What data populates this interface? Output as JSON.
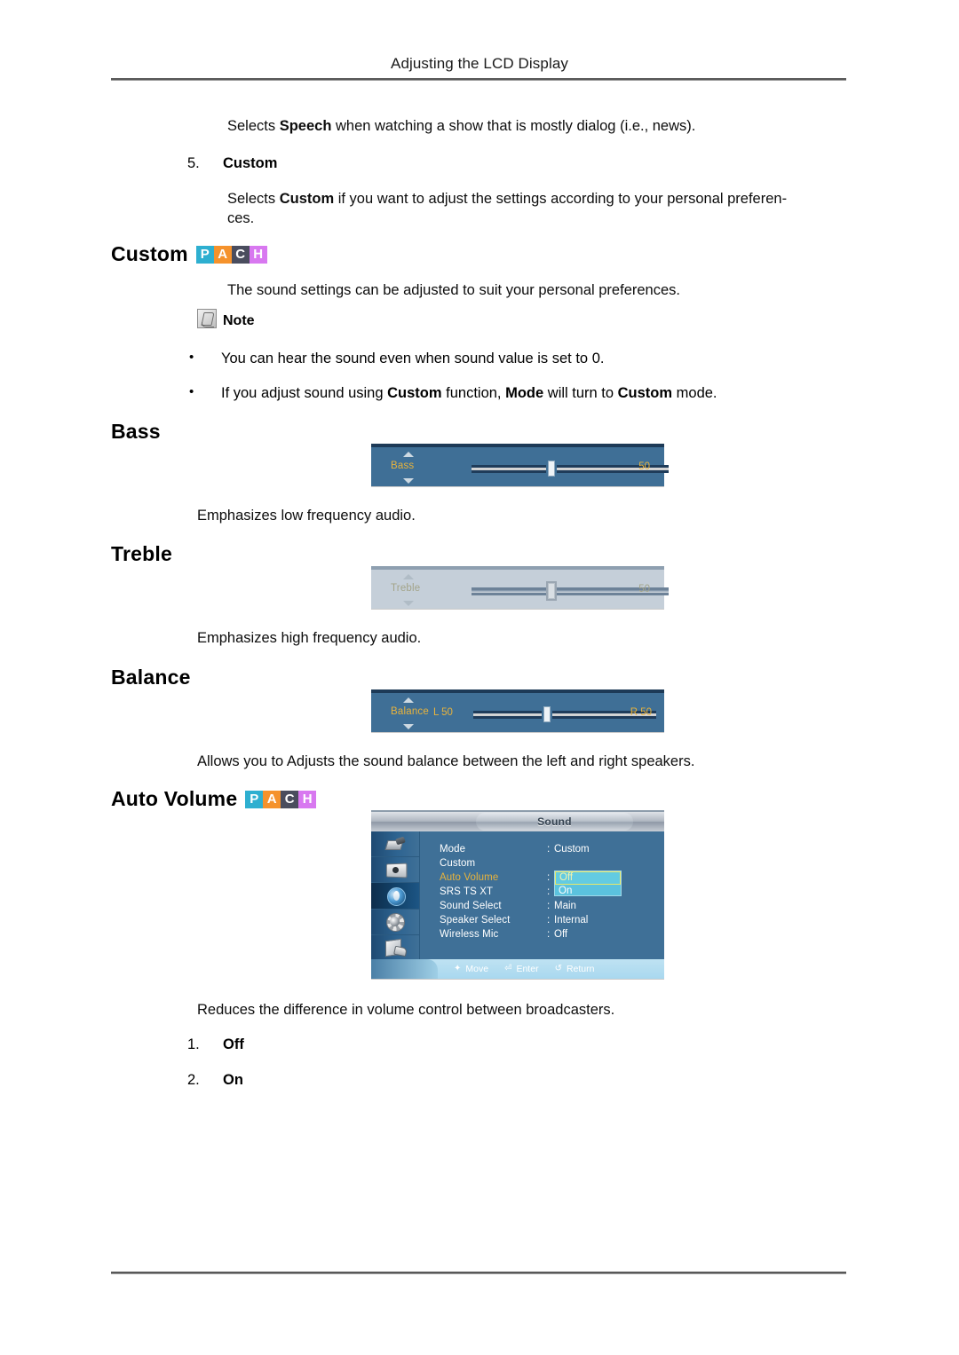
{
  "page": {
    "header_title": "Adjusting the LCD Display"
  },
  "content": {
    "intro_paragraph_html": "Selects <b>Speech</b> when watching a show that is mostly dialog (i.e., news).",
    "intro_paragraph": "Selects Speech when watching a show that is mostly dialog (i.e., news).",
    "list_item_5": {
      "number": "5.",
      "label": "Custom"
    },
    "custom_description": "Selects Custom if you want to adjust the settings according to your personal preferen-",
    "custom_description_cont": "ces."
  },
  "sections": {
    "custom": {
      "heading": "Custom",
      "badges": [
        "P",
        "A",
        "C",
        "H"
      ],
      "description": "The sound settings can be adjusted to suit your personal preferences."
    },
    "note": {
      "label": "Note",
      "bullets": [
        "You can hear the sound even when sound value is set to 0.",
        "If you adjust sound using Custom function, Mode will turn to Custom mode."
      ]
    },
    "bass": {
      "heading": "Bass",
      "description": "Emphasizes low frequency audio."
    },
    "treble": {
      "heading": "Treble",
      "description": "Emphasizes high frequency audio."
    },
    "balance": {
      "heading": "Balance",
      "description": "Allows you to Adjusts the sound balance between the left and right speakers."
    },
    "auto_volume": {
      "heading": "Auto Volume",
      "badges": [
        "P",
        "A",
        "C",
        "H"
      ],
      "description": "Reduces the difference in volume control between broadcasters.",
      "options": [
        {
          "number": "1.",
          "label": "Off"
        },
        {
          "number": "2.",
          "label": "On"
        }
      ]
    }
  },
  "osd_sliders": {
    "bass": {
      "label": "Bass",
      "value": "50"
    },
    "treble": {
      "label": "Treble",
      "value": "50"
    },
    "balance": {
      "label": "Balance",
      "left": "L  50",
      "right": "R  50"
    }
  },
  "osd_menu": {
    "title": "Sound",
    "sidebar_icons": [
      "input-icon",
      "picture-icon",
      "sound-icon",
      "setup-icon",
      "multi-control-icon"
    ],
    "active_sidebar_index": 2,
    "rows": [
      {
        "label": "Mode",
        "value": "Custom"
      },
      {
        "label": "Custom",
        "value": ""
      },
      {
        "label": "Auto Volume",
        "value": "",
        "highlighted": true
      },
      {
        "label": "SRS TS XT",
        "value": ""
      },
      {
        "label": "Sound Select",
        "value": "Main"
      },
      {
        "label": "Speaker Select",
        "value": "Internal"
      },
      {
        "label": "Wireless Mic",
        "value": "Off"
      }
    ],
    "dropdown": {
      "options": [
        "Off",
        "On"
      ],
      "selected": "Off"
    },
    "bottom_bar": [
      {
        "icon": "move-icon",
        "label": "Move"
      },
      {
        "icon": "enter-icon",
        "label": "Enter"
      },
      {
        "icon": "return-icon",
        "label": "Return"
      }
    ]
  },
  "colors": {
    "badge_p": "#2eafd0",
    "badge_a": "#f5922c",
    "badge_c": "#4a4d5e",
    "badge_h": "#d878f0",
    "osd_blue": "#3f6f96",
    "osd_gold": "#e8b33c",
    "osd_cyan": "#5bc2de",
    "osd_bottom": "#a9d8ef"
  }
}
